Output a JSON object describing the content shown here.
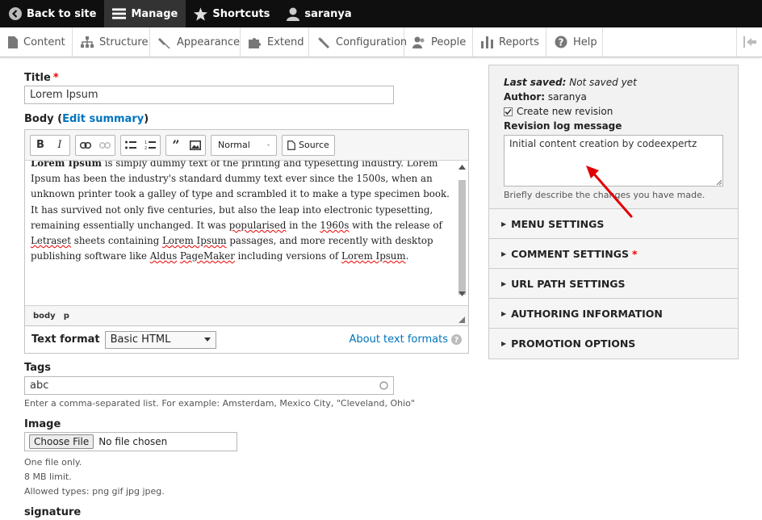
{
  "toolbar": {
    "back": "Back to site",
    "manage": "Manage",
    "shortcuts": "Shortcuts",
    "user": "saranya"
  },
  "tray": {
    "items": [
      "Content",
      "Structure",
      "Appearance",
      "Extend",
      "Configuration",
      "People",
      "Reports",
      "Help"
    ]
  },
  "form": {
    "title_label": "Title",
    "title_value": "Lorem Ipsum",
    "body_label": "Body",
    "edit_summary": "Edit summary",
    "format_dropdown": "Normal",
    "source_label": "Source",
    "body_text_lead": "Lorem Ipsum",
    "body_text_1": " is simply dummy text of the printing and typesetting industry. Lorem Ipsum has been the industry's standard dummy text ever since the 1500s, when an unknown printer took a galley of type and scrambled it to make a type specimen book. It has survived not only five centuries, but also the leap into electronic typesetting, remaining essentially unchanged. It was ",
    "popularised": "popularised",
    "body_text_2": " in the ",
    "sixties": "1960s",
    "body_text_3": " with the release of ",
    "letraset": "Letraset",
    "body_text_4": " sheets containing ",
    "lorem_ipsum_link": "Lorem Ipsum",
    "body_text_5": " passages, and more recently with desktop publishing software like ",
    "aldus": "Aldus",
    "pagemaker": "PageMaker",
    "body_text_6": " including versions of ",
    "lorem_ipsum_end": "Lorem Ipsum",
    "body_text_7": ".",
    "path_body": "body",
    "path_p": "p",
    "text_format_label": "Text format",
    "text_format_value": "Basic HTML",
    "about_formats": "About text formats",
    "tags_label": "Tags",
    "tags_value": "abc",
    "tags_desc": "Enter a comma-separated list. For example: Amsterdam, Mexico City, \"Cleveland, Ohio\"",
    "image_label": "Image",
    "choose_file": "Choose File",
    "no_file": "No file chosen",
    "image_desc_1": "One file only.",
    "image_desc_2": "8 MB limit.",
    "image_desc_3": "Allowed types: png gif jpg jpeg.",
    "signature_label": "signature"
  },
  "sidebar": {
    "last_saved_label": "Last saved:",
    "last_saved_value": "Not saved yet",
    "author_label": "Author:",
    "author_value": "saranya",
    "create_revision": "Create new revision",
    "revision_log_label": "Revision log message",
    "revision_log_value": "Initial content creation by codeexpertz",
    "revision_desc": "Briefly describe the changes you have made.",
    "sections": [
      "MENU SETTINGS",
      "COMMENT SETTINGS",
      "URL PATH SETTINGS",
      "AUTHORING INFORMATION",
      "PROMOTION OPTIONS"
    ]
  },
  "colors": {
    "link": "#0074bd",
    "required": "#e00000",
    "annotation_arrow": "#e00000"
  }
}
